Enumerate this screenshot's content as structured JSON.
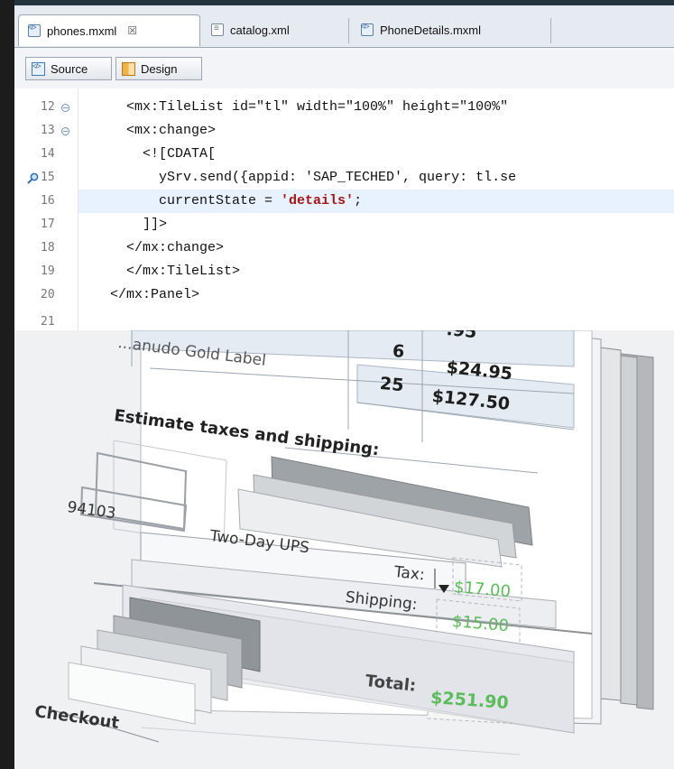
{
  "tabs": [
    {
      "label": "phones.mxml",
      "close": "☒",
      "active": true
    },
    {
      "label": "catalog.xml",
      "active": false
    },
    {
      "label": "PhoneDetails.mxml",
      "active": false
    }
  ],
  "modes": {
    "source": "Source",
    "design": "Design"
  },
  "code_lines": [
    {
      "num": "12",
      "text": "    <mx:TileList id=\"tl\" width=\"100%\" height=\"100%\"",
      "fold": true
    },
    {
      "num": "13",
      "text": "    <mx:change>",
      "fold": true
    },
    {
      "num": "14",
      "text": "      <![CDATA["
    },
    {
      "num": "15",
      "text": "        ySrv.send({appid: 'SAP_TECHED', query: tl.se",
      "marker": true
    },
    {
      "num": "16",
      "text_a": "        currentState = ",
      "text_b": "'details'",
      "text_c": ";",
      "current": true
    },
    {
      "num": "17",
      "text": "      ]]>"
    },
    {
      "num": "18",
      "text": "    </mx:change>"
    },
    {
      "num": "19",
      "text": "    </mx:TileList>"
    },
    {
      "num": "20",
      "text": "  </mx:Panel>"
    },
    {
      "num": "21",
      "text": ""
    }
  ],
  "order": {
    "row1_price": ".95",
    "row2": {
      "name": "...anudo Gold Label",
      "qty": "6",
      "price": "$24.95"
    },
    "row3": {
      "qty": "25",
      "price": "$127.50"
    }
  },
  "shipping": {
    "heading": "Estimate taxes and shipping:",
    "zip": "94103",
    "method": "Two-Day UPS",
    "tax_label": "Tax:",
    "tax_value": "$17.00",
    "shipping_label": "Shipping:",
    "shipping_value": "$15.00",
    "total_label": "Total:",
    "total_value": "$251.90",
    "checkout_label": "Checkout"
  },
  "colors": {
    "accent_green": "#5cbc5b",
    "current_line": "#e8f2fe",
    "string_red": "#a31515"
  }
}
